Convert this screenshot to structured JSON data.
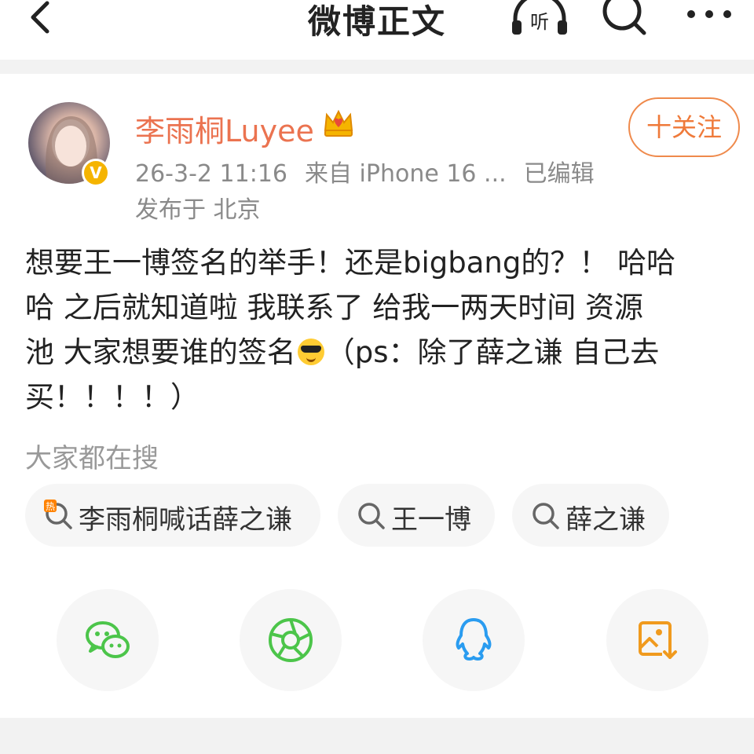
{
  "header": {
    "title": "微博正文",
    "listen_label": "听"
  },
  "post": {
    "author_name": "李雨桐Luyee",
    "timestamp": "26-3-2 11:16",
    "source": "来自 iPhone 16 ...",
    "edited": "已编辑",
    "location": "发布于 北京",
    "follow_label": "十关注",
    "verified_mark": "V",
    "body": {
      "line1": "想要王一博签名的举手！还是bigbang的？！  哈哈",
      "line2": "哈 之后就知道啦 我联系了 给我一两天时间 资源",
      "line3_a": "池 大家想要谁的签名",
      "line3_b": "（ps：除了薛之谦 自己去",
      "line4": "买！！！！）"
    }
  },
  "trending": {
    "label": "大家都在搜",
    "items": [
      {
        "text": "李雨桐喊话薛之谦",
        "icon": "hot-search-icon"
      },
      {
        "text": "王一博",
        "icon": "search-icon"
      },
      {
        "text": "薛之谦",
        "icon": "search-icon"
      }
    ]
  },
  "share": {
    "items": [
      {
        "icon": "wechat-icon",
        "color": "#4cc54a"
      },
      {
        "icon": "moments-icon",
        "color": "#4cc54a"
      },
      {
        "icon": "qq-icon",
        "color": "#2a9cf0"
      },
      {
        "icon": "save-image-icon",
        "color": "#f09a1e"
      }
    ]
  },
  "colors": {
    "accent": "#eb7350",
    "follow": "#ef7a3a",
    "meta_text": "#8a8a8a",
    "chip_bg": "#f6f6f6",
    "page_band": "#f2f2f2"
  }
}
